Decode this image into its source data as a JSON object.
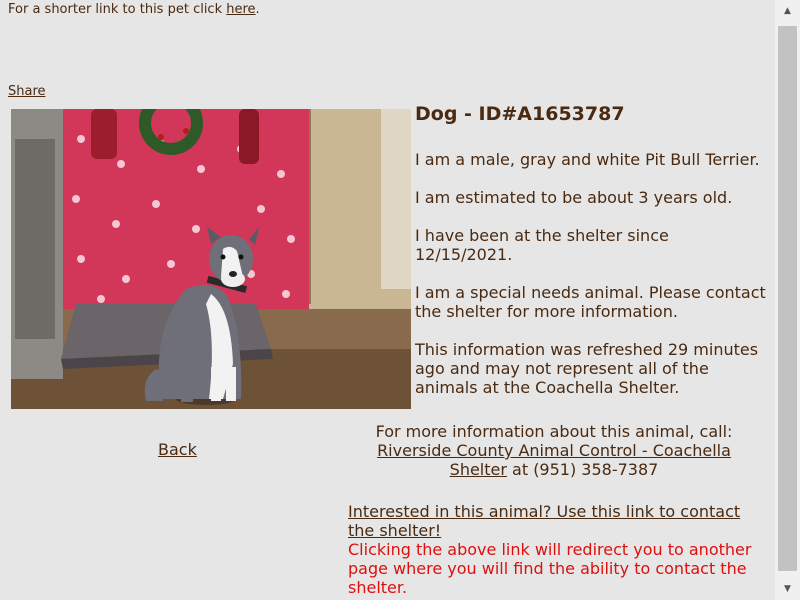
{
  "header": {
    "shortlink_prefix": "For a shorter link to this pet click ",
    "shortlink_link": "here",
    "shortlink_suffix": ".",
    "share": "Share"
  },
  "pet": {
    "title": "Dog - ID#A1653787",
    "para1": "I am a male, gray and white Pit Bull Terrier.",
    "para2": "I am estimated to be about 3 years old.",
    "para3": "I have been at the shelter since 12/15/2021.",
    "para4": "I am a special needs animal. Please contact the shelter for more information.",
    "para5": "This information was refreshed 29 minutes ago and may not represent all of the animals at the Coachella Shelter."
  },
  "nav": {
    "back": "Back"
  },
  "contact": {
    "intro": "For more information about this animal, call:",
    "shelter_link": "Riverside County Animal Control - Coachella Shelter",
    "phone": " at (951) 358-7387"
  },
  "interest": {
    "link": "Interested in this animal? Use this link to contact the shelter!",
    "redirect_note": "Clicking the above link will redirect you to another page where you will find the ability to contact the shelter."
  },
  "colors": {
    "text": "#4a2a10",
    "warning": "#dd1010",
    "background": "#e6e6e6"
  },
  "icons": {
    "scroll_up": "triangle-up-icon",
    "scroll_down": "triangle-down-icon"
  }
}
